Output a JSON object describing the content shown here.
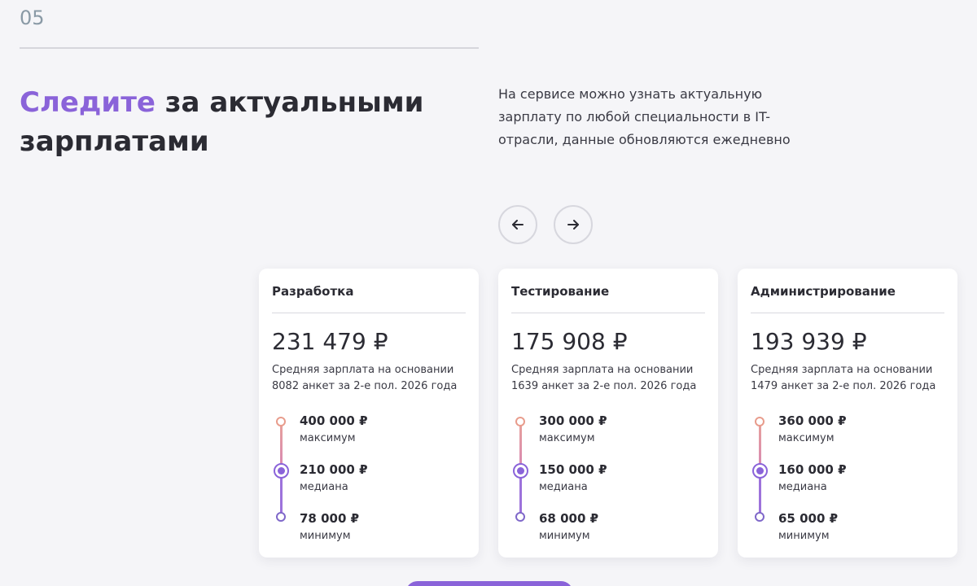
{
  "section": {
    "number": "05"
  },
  "heading": {
    "accent": "Следите",
    "rest": " за актуальными зарплатами"
  },
  "description": "На сервисе можно узнать актуальную зарплату по любой специальности в IT-отрасли, данные обновляются ежедневно",
  "colors": {
    "accent": "#8a63d9",
    "max_dot": "#e89c8c",
    "min_dot": "#7f68c9"
  },
  "icons": {
    "prev": "arrow-left-icon",
    "next": "arrow-right-icon"
  },
  "cards": [
    {
      "title": "Разработка",
      "average": "231 479 ₽",
      "note": "Средняя зарплата на основании 8082 анкет за 2-е пол. 2026 года",
      "max_value": "400 000 ₽",
      "max_label": "максимум",
      "median_value": "210 000 ₽",
      "median_label": "медиана",
      "min_value": "78 000 ₽",
      "min_label": "минимум"
    },
    {
      "title": "Тестирование",
      "average": "175 908 ₽",
      "note": "Средняя зарплата на основании 1639 анкет за 2-е пол. 2026 года",
      "max_value": "300 000 ₽",
      "max_label": "максимум",
      "median_value": "150 000 ₽",
      "median_label": "медиана",
      "min_value": "68 000 ₽",
      "min_label": "минимум"
    },
    {
      "title": "Администрирование",
      "average": "193 939 ₽",
      "note": "Средняя зарплата на основании 1479 анкет за 2-е пол. 2026 года",
      "max_value": "360 000 ₽",
      "max_label": "максимум",
      "median_value": "160 000 ₽",
      "median_label": "медиана",
      "min_value": "65 000 ₽",
      "min_label": "минимум"
    }
  ]
}
